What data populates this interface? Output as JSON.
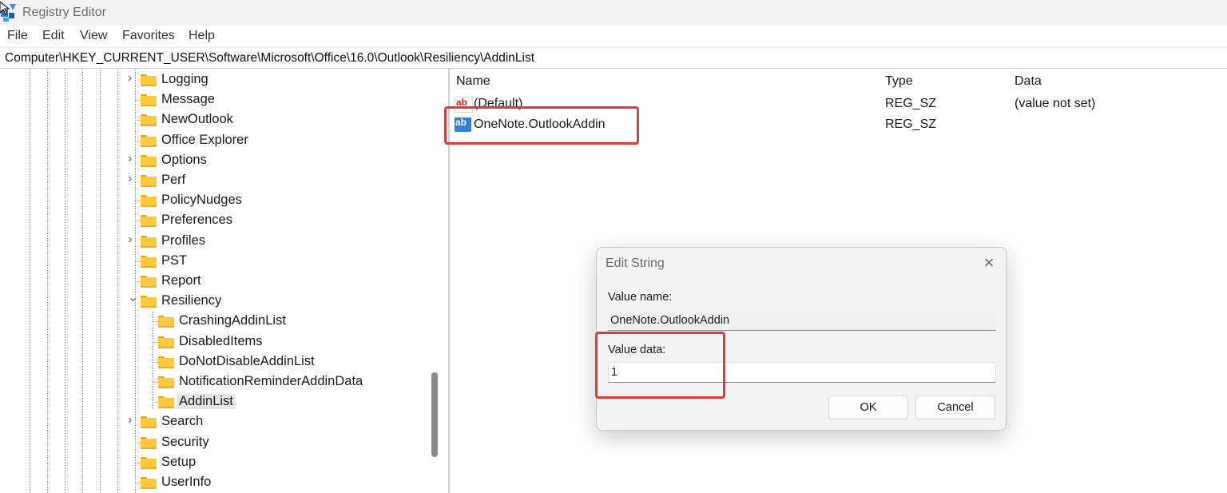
{
  "window": {
    "title": "Registry Editor",
    "icon": "registry-editor-icon"
  },
  "menu": [
    "File",
    "Edit",
    "View",
    "Favorites",
    "Help"
  ],
  "address": "Computer\\HKEY_CURRENT_USER\\Software\\Microsoft\\Office\\16.0\\Outlook\\Resiliency\\AddinList",
  "tree": [
    {
      "label": "Logging",
      "expander": ">"
    },
    {
      "label": "Message",
      "expander": ""
    },
    {
      "label": "NewOutlook",
      "expander": ""
    },
    {
      "label": "Office Explorer",
      "expander": ""
    },
    {
      "label": "Options",
      "expander": ">"
    },
    {
      "label": "Perf",
      "expander": ">"
    },
    {
      "label": "PolicyNudges",
      "expander": ""
    },
    {
      "label": "Preferences",
      "expander": ""
    },
    {
      "label": "Profiles",
      "expander": ">"
    },
    {
      "label": "PST",
      "expander": ""
    },
    {
      "label": "Report",
      "expander": ""
    },
    {
      "label": "Resiliency",
      "expander": "v"
    },
    {
      "label": "CrashingAddinList",
      "expander": ""
    },
    {
      "label": "DisabledItems",
      "expander": ""
    },
    {
      "label": "DoNotDisableAddinList",
      "expander": ""
    },
    {
      "label": "NotificationReminderAddinData",
      "expander": ""
    },
    {
      "label": "AddinList",
      "expander": "",
      "selected": true
    },
    {
      "label": "Search",
      "expander": ">"
    },
    {
      "label": "Security",
      "expander": ""
    },
    {
      "label": "Setup",
      "expander": ""
    },
    {
      "label": "UserInfo",
      "expander": ""
    }
  ],
  "values": {
    "columns": [
      "Name",
      "Type",
      "Data"
    ],
    "rows": [
      {
        "name": "(Default)",
        "type": "REG_SZ",
        "data": "(value not set)",
        "icon": "string-value-icon"
      },
      {
        "name": "OneNote.OutlookAddin",
        "type": "REG_SZ",
        "data": "",
        "icon": "string-value-icon"
      }
    ]
  },
  "dialog": {
    "title": "Edit String",
    "value_name_label": "Value name:",
    "value_name": "OneNote.OutlookAddin",
    "value_data_label": "Value data:",
    "value_data": "1",
    "ok_label": "OK",
    "cancel_label": "Cancel"
  },
  "colors": {
    "highlight": "#e03b3b",
    "folder": "#ffc83d"
  }
}
